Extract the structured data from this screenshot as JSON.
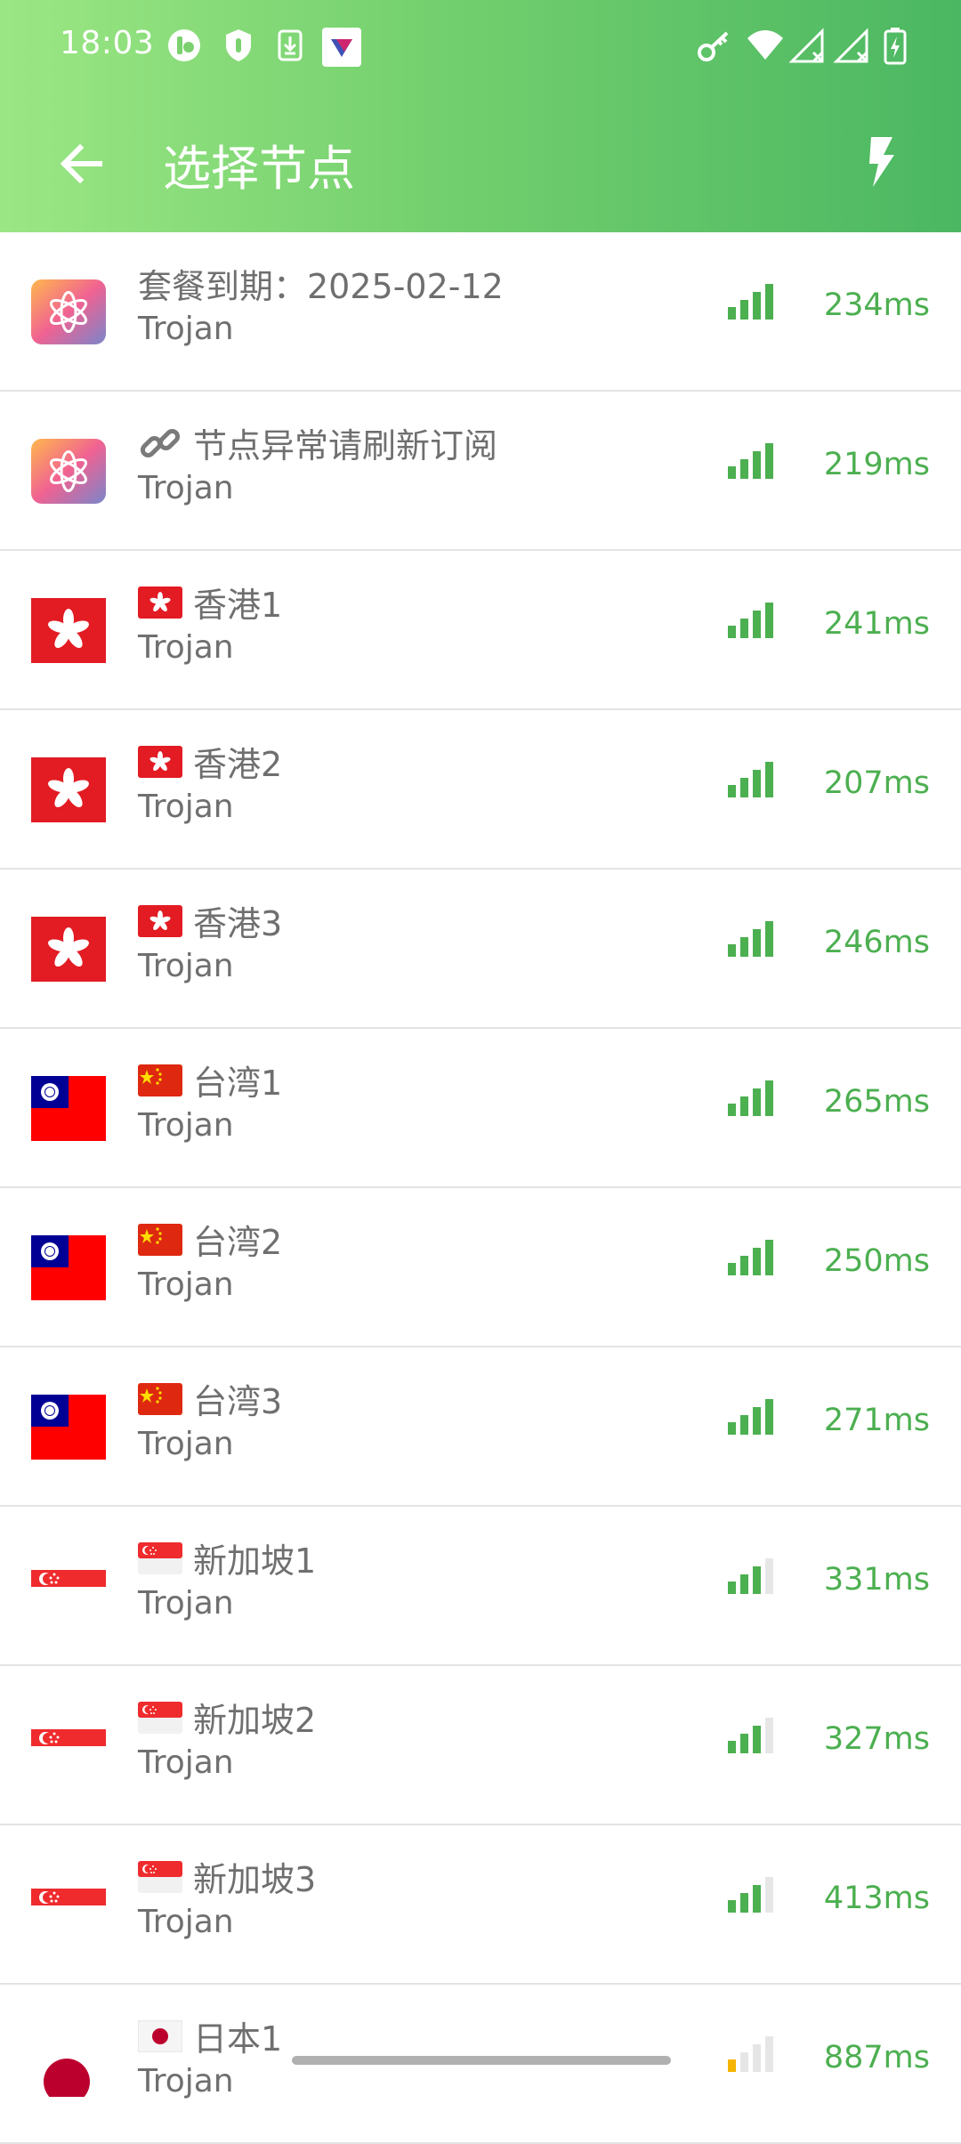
{
  "status_bar": {
    "time": "18:03",
    "left_icons": [
      "app-notification-icon",
      "shield-notification-icon",
      "download-icon",
      "vpn-app-icon"
    ],
    "right_icons": [
      "vpn-key-icon",
      "wifi-icon",
      "signal-no-service-icon",
      "signal-no-service-icon",
      "battery-charging-icon"
    ]
  },
  "toolbar": {
    "title": "选择节点",
    "back_icon": "arrow-back-icon",
    "action_icon": "flash-bolt-icon"
  },
  "colors": {
    "accent_start": "#9be684",
    "accent_end": "#4bb762",
    "latency": "#4caf50",
    "signal_full": "#4caf50",
    "signal_weak": "#f4b400"
  },
  "nodes": [
    {
      "name": "套餐到期：2025-02-12",
      "protocol": "Trojan",
      "latency": "234ms",
      "signal_level": 4,
      "icon": "app-logo-icon",
      "emoji": ""
    },
    {
      "name": "节点异常请刷新订阅",
      "protocol": "Trojan",
      "latency": "219ms",
      "signal_level": 4,
      "icon": "app-logo-icon",
      "emoji": "link"
    },
    {
      "name": "香港1",
      "protocol": "Trojan",
      "latency": "241ms",
      "signal_level": 4,
      "icon": "hong-kong-flag-icon",
      "emoji": "hk"
    },
    {
      "name": "香港2",
      "protocol": "Trojan",
      "latency": "207ms",
      "signal_level": 4,
      "icon": "hong-kong-flag-icon",
      "emoji": "hk"
    },
    {
      "name": "香港3",
      "protocol": "Trojan",
      "latency": "246ms",
      "signal_level": 4,
      "icon": "hong-kong-flag-icon",
      "emoji": "hk"
    },
    {
      "name": "台湾1",
      "protocol": "Trojan",
      "latency": "265ms",
      "signal_level": 4,
      "icon": "taiwan-flag-icon",
      "emoji": "cn"
    },
    {
      "name": "台湾2",
      "protocol": "Trojan",
      "latency": "250ms",
      "signal_level": 4,
      "icon": "taiwan-flag-icon",
      "emoji": "cn"
    },
    {
      "name": "台湾3",
      "protocol": "Trojan",
      "latency": "271ms",
      "signal_level": 4,
      "icon": "taiwan-flag-icon",
      "emoji": "cn"
    },
    {
      "name": "新加坡1",
      "protocol": "Trojan",
      "latency": "331ms",
      "signal_level": 3,
      "icon": "singapore-flag-icon",
      "emoji": "sg"
    },
    {
      "name": "新加坡2",
      "protocol": "Trojan",
      "latency": "327ms",
      "signal_level": 3,
      "icon": "singapore-flag-icon",
      "emoji": "sg"
    },
    {
      "name": "新加坡3",
      "protocol": "Trojan",
      "latency": "413ms",
      "signal_level": 3,
      "icon": "singapore-flag-icon",
      "emoji": "sg"
    },
    {
      "name": "日本1",
      "protocol": "Trojan",
      "latency": "887ms",
      "signal_level": 1,
      "icon": "japan-flag-icon",
      "emoji": "jp"
    }
  ]
}
